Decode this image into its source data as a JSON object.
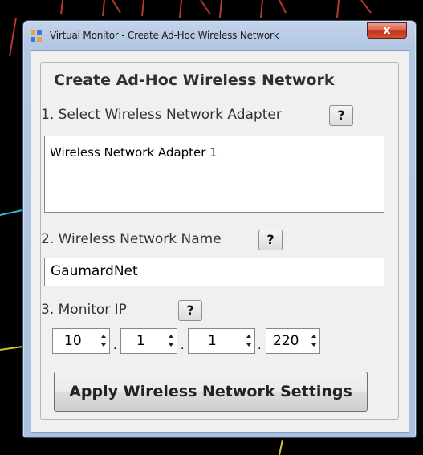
{
  "window": {
    "title": "Virtual Monitor - Create Ad-Hoc Wireless Network",
    "close_label": "x"
  },
  "group": {
    "title": "Create Ad-Hoc Wireless Network"
  },
  "adapter": {
    "label": "1. Select Wireless Network Adapter",
    "help": "?",
    "items": [
      "Wireless Network Adapter 1"
    ]
  },
  "network_name": {
    "label": "2. Wireless Network Name",
    "help": "?",
    "value": "GaumardNet"
  },
  "monitor_ip": {
    "label": "3. Monitor IP",
    "help": "?",
    "octets": [
      "10",
      "1",
      "1",
      "220"
    ],
    "separator": "."
  },
  "apply_button": "Apply Wireless Network Settings",
  "colors": {
    "background": "#000000",
    "trace_red": "#c0392b",
    "trace_teal": "#2fb7c8",
    "trace_yellow": "#d4c22a",
    "close_button": "#c94a2f"
  }
}
